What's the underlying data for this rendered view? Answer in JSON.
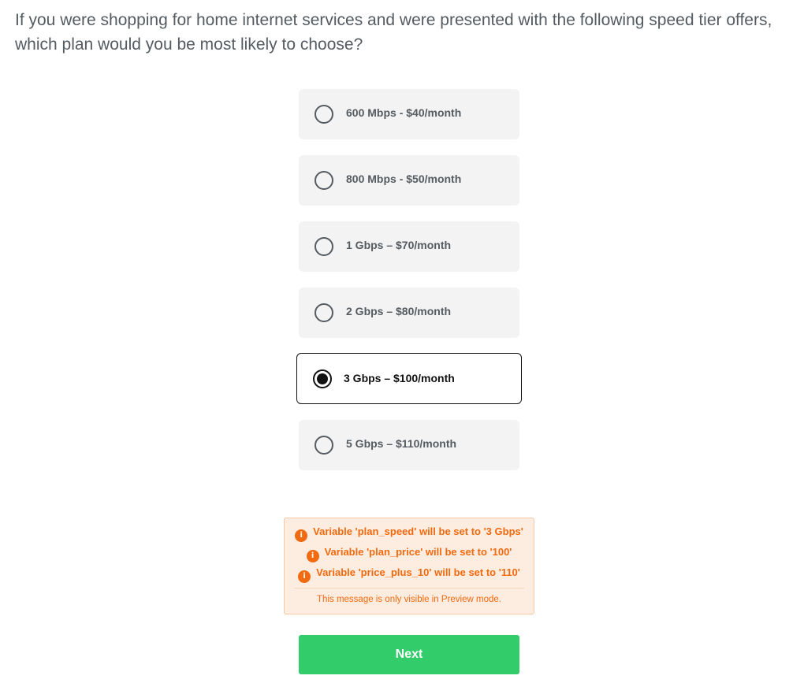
{
  "question": {
    "text": "If you were shopping for home internet services and were presented with the following speed tier offers, which plan would you be most likely to choose?"
  },
  "options": [
    {
      "label": "600 Mbps - $40/month",
      "selected": false
    },
    {
      "label": "800 Mbps - $50/month",
      "selected": false
    },
    {
      "label": "1 Gbps – $70/month",
      "selected": false
    },
    {
      "label": "2 Gbps – $80/month",
      "selected": false
    },
    {
      "label": "3 Gbps – $100/month",
      "selected": true
    },
    {
      "label": "5 Gbps – $110/month",
      "selected": false
    }
  ],
  "preview": {
    "variables": [
      "Variable 'plan_speed' will be set to '3 Gbps'",
      "Variable 'plan_price' will be set to '100'",
      "Variable 'price_plus_10' will be set to '110'"
    ],
    "info_icon_glyph": "i",
    "note": "This message is only visible in Preview mode.",
    "accent_color": "#f26a0f"
  },
  "next_button": {
    "label": "Next",
    "color": "#32cc6a"
  }
}
